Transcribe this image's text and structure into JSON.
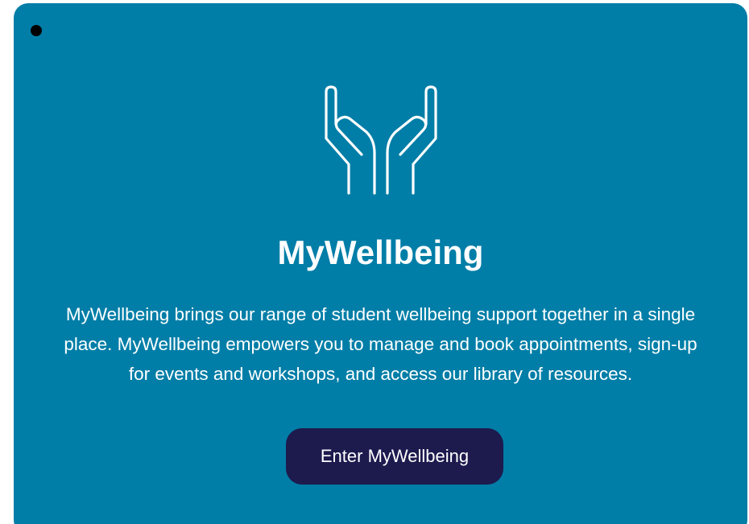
{
  "card": {
    "background": "#007ea7",
    "icon": "open-hands-icon",
    "title": "MyWellbeing",
    "description": "MyWellbeing brings our range of student wellbeing support together in a single place. MyWellbeing empowers you to manage and book appointments, sign-up for events and workshops, and access our library of resources.",
    "button_label": "Enter MyWellbeing",
    "button_color": "#1d1a4e"
  }
}
